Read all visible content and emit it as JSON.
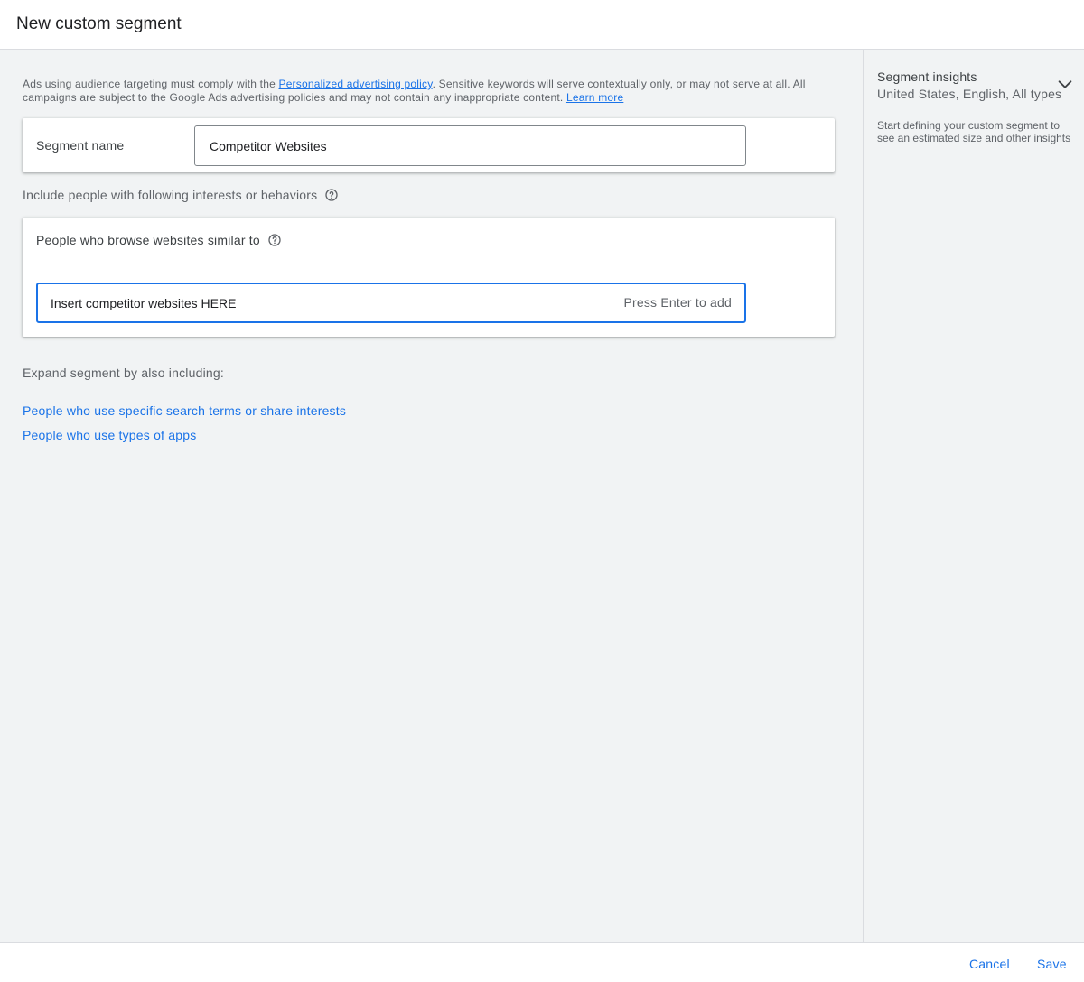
{
  "header": {
    "title": "New custom segment"
  },
  "policy": {
    "text_1": "Ads using audience targeting must comply with the ",
    "link_policy": "Personalized advertising policy",
    "text_2": ". Sensitive keywords will serve contextually only, or may not serve at all. All campaigns are subject to the Google Ads advertising policies and may not contain any inappropriate content. ",
    "link_learn": "Learn more"
  },
  "segment_name": {
    "label": "Segment name",
    "value": "Competitor Websites"
  },
  "include": {
    "label": "Include people with following interests or behaviors",
    "help_icon": "help-circle-icon"
  },
  "browse": {
    "label": "People who browse websites similar to",
    "help_icon": "help-circle-icon",
    "input_placeholder": "Insert competitor websites HERE",
    "hint": "Press Enter to add"
  },
  "expand": {
    "label": "Expand segment by also including:",
    "links": [
      "People who use specific search terms or share interests",
      "People who use types of apps"
    ]
  },
  "insights": {
    "title": "Segment insights",
    "subtitle": "United States, English, All types",
    "chevron_icon": "chevron-down-icon",
    "description": "Start defining your custom segment to see an estimated size and other insights"
  },
  "footer": {
    "cancel_label": "Cancel",
    "save_label": "Save"
  },
  "colors": {
    "accent": "#1a73e8",
    "background": "#f1f3f4",
    "card": "#ffffff",
    "text": "#3c4043",
    "muted_text": "#5f6368"
  }
}
